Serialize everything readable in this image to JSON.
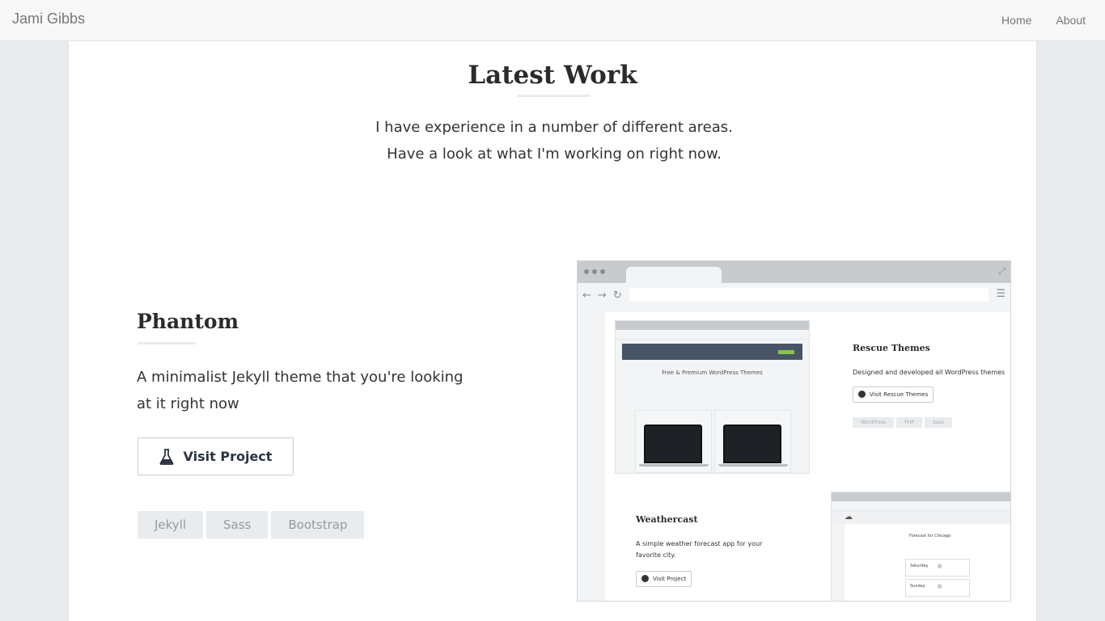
{
  "nav": {
    "brand": "Jami Gibbs",
    "links": [
      {
        "label": "Home"
      },
      {
        "label": "About"
      }
    ]
  },
  "section": {
    "title": "Latest Work",
    "intro": "I have experience in a number of different areas. Have a look at what I'm working on right now."
  },
  "project": {
    "name": "Phantom",
    "description": "A minimalist Jekyll theme that you're looking at it right now",
    "button_label": "Visit Project",
    "button_icon": "flask-icon",
    "tags": [
      "Jekyll",
      "Sass",
      "Bootstrap"
    ]
  },
  "preview": {
    "rescue": {
      "headline": "Free & Premium WordPress Themes",
      "title": "Rescue Themes",
      "description": "Designed and developed all WordPress themes",
      "button_label": "Visit Rescue Themes",
      "tags": [
        "WordPress",
        "PHP",
        "Sass"
      ]
    },
    "weathercast": {
      "title": "Weathercast",
      "description": "A simple weather forecast app for your favorite city.",
      "button_label": "Visit Project",
      "forecast_title": "Forecast for Chicago",
      "days": [
        "Saturday",
        "Sunday"
      ]
    }
  },
  "colors": {
    "nav_bg": "#f8f8f8",
    "page_bg": "#e8ecef",
    "tag_bg": "#e9ecef",
    "heading": "#2b2b2b"
  }
}
